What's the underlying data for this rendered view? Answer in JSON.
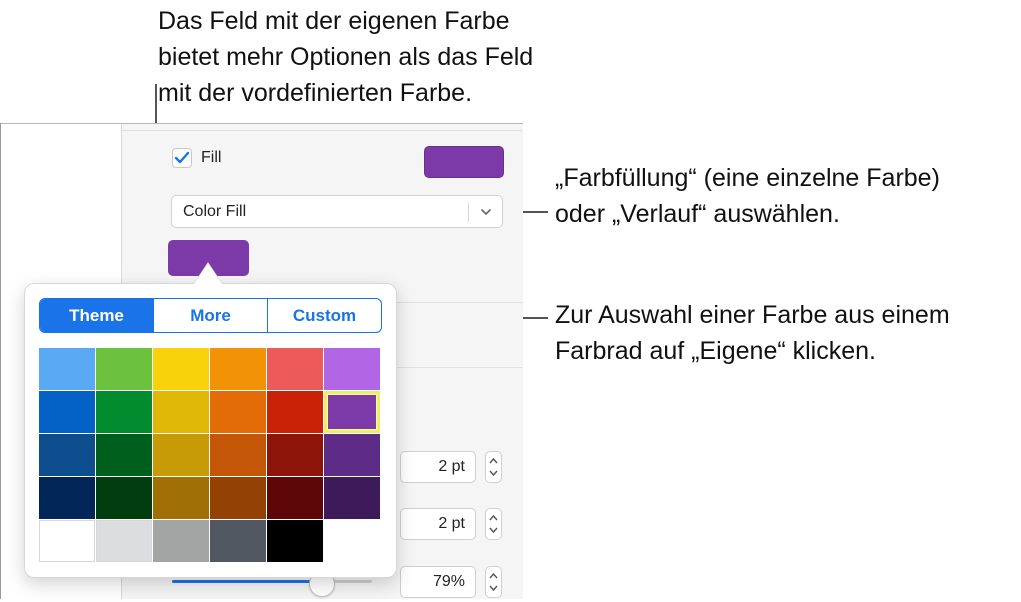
{
  "callouts": {
    "top": [
      "Das Feld mit der eigenen Farbe",
      "bietet mehr Optionen als das Feld",
      "mit der vordefinierten Farbe."
    ],
    "right_fill": [
      "„Farbfüllung“ (eine einzelne Farbe)",
      "oder „Verlauf“ auswählen."
    ],
    "right_custom": [
      "Zur Auswahl einer Farbe aus einem",
      "Farbrad auf „Eigene“ klicken."
    ]
  },
  "inspector": {
    "fill_label": "Fill",
    "fill_checked": true,
    "fill_color": "#7c3aa8",
    "fill_type_select": "Color Fill",
    "fields": [
      {
        "value": "2 pt"
      },
      {
        "value": "2 pt"
      },
      {
        "value": "79%"
      }
    ],
    "slider_value": 0.7
  },
  "popover": {
    "tabs": [
      {
        "label": "Theme",
        "active": true
      },
      {
        "label": "More",
        "active": false
      },
      {
        "label": "Custom",
        "active": false
      }
    ],
    "accent_color": "#1a73e8",
    "swatches": [
      [
        "#5aa9f5",
        "#6cc23f",
        "#f8d30b",
        "#f29207",
        "#ec5b59",
        "#b066e5"
      ],
      [
        "#0461c6",
        "#028b2f",
        "#e0b808",
        "#e36b08",
        "#c92207",
        "#7c3aa8"
      ],
      [
        "#0d4c8d",
        "#015f1e",
        "#c79b07",
        "#c35707",
        "#8d1409",
        "#5c2c87"
      ],
      [
        "#012657",
        "#013d0f",
        "#a06f06",
        "#934105",
        "#5d0708",
        "#3d1b5a"
      ],
      [
        "#ffffff",
        "#dcdddf",
        "#a3a5a5",
        "#525862",
        "#000000",
        null
      ]
    ],
    "selected_swatch": [
      1,
      5
    ]
  }
}
